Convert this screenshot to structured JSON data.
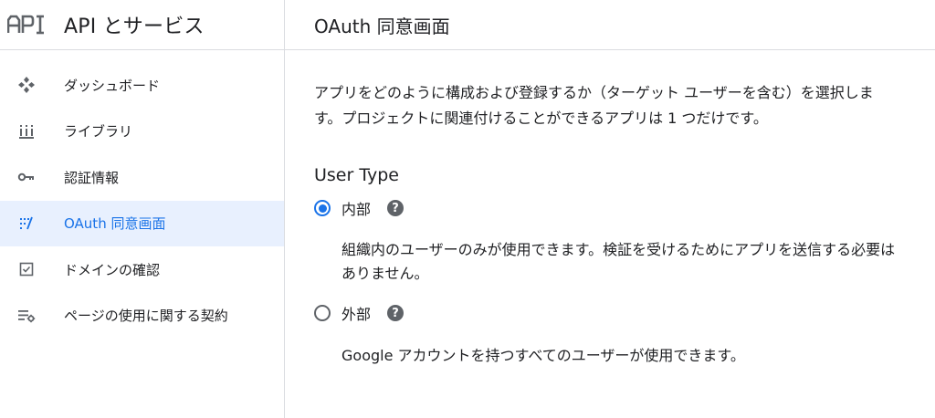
{
  "sidebar": {
    "logo_text": "API",
    "title": "API とサービス",
    "items": [
      {
        "label": "ダッシュボード",
        "icon": "dashboard-icon",
        "active": false
      },
      {
        "label": "ライブラリ",
        "icon": "library-icon",
        "active": false
      },
      {
        "label": "認証情報",
        "icon": "key-icon",
        "active": false
      },
      {
        "label": "OAuth 同意画面",
        "icon": "consent-screen-icon",
        "active": true
      },
      {
        "label": "ドメインの確認",
        "icon": "checkbox-icon",
        "active": false
      },
      {
        "label": "ページの使用に関する契約",
        "icon": "settings-list-icon",
        "active": false
      }
    ]
  },
  "main": {
    "title": "OAuth 同意画面",
    "description": "アプリをどのように構成および登録するか（ターゲット ユーザーを含む）を選択します。プロジェクトに関連付けることができるアプリは 1 つだけです。",
    "user_type": {
      "heading": "User Type",
      "options": [
        {
          "label": "内部",
          "selected": true,
          "help": "?",
          "description": "組織内のユーザーのみが使用できます。検証を受けるためにアプリを送信する必要はありません。"
        },
        {
          "label": "外部",
          "selected": false,
          "help": "?",
          "description": "Google アカウントを持つすべてのユーザーが使用できます。"
        }
      ]
    }
  },
  "colors": {
    "accent": "#1a73e8",
    "active_bg": "#e8f0fe",
    "icon_grey": "#5f6368",
    "divider": "#dadce0"
  }
}
